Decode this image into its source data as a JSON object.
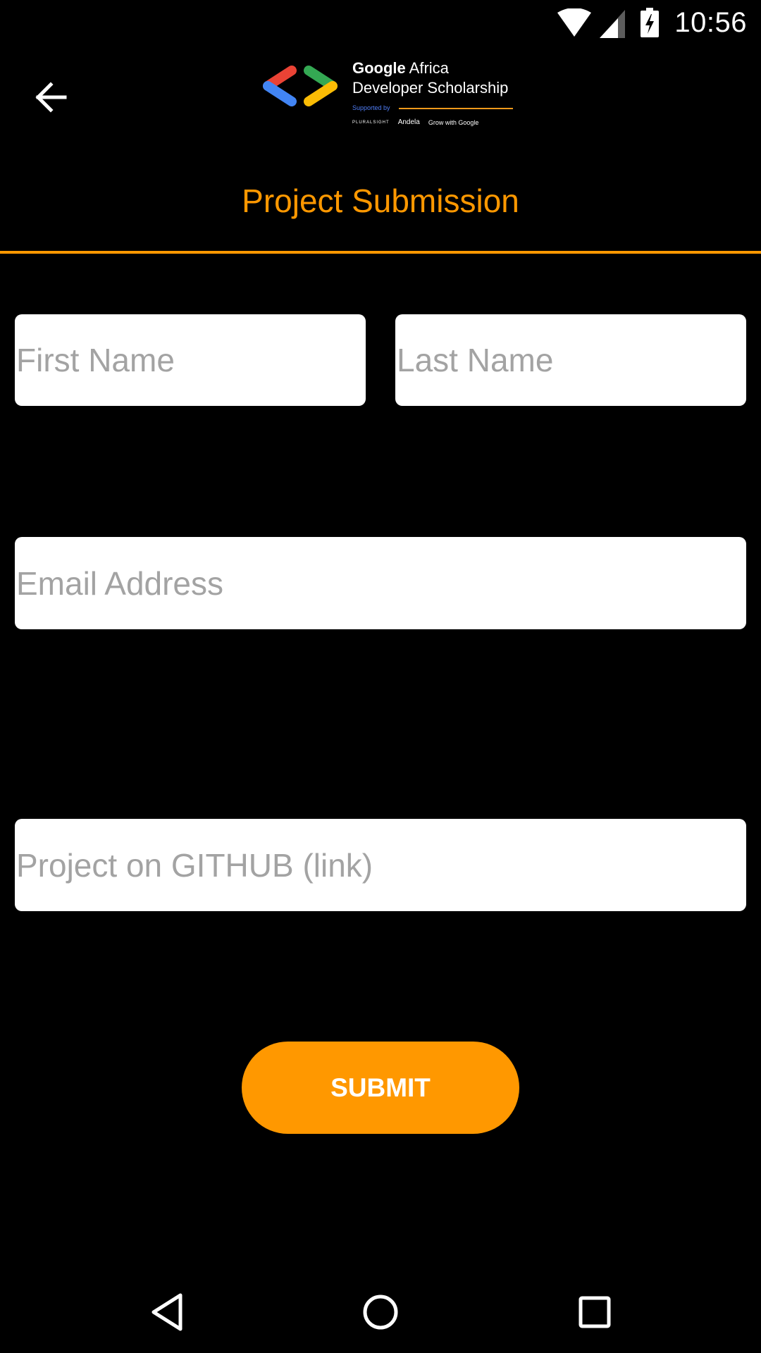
{
  "status_bar": {
    "time": "10:56",
    "icons": [
      "wifi-icon",
      "cellular-signal-icon",
      "battery-charging-icon"
    ]
  },
  "header": {
    "back_icon": "arrow-left-icon",
    "logo": {
      "line1_bold": "Google",
      "line1_rest": " Africa",
      "line2": "Developer Scholarship",
      "supported_by": "Supported by",
      "sponsors": [
        "PLURALSIGHT",
        "Andela",
        "Grow with Google"
      ]
    },
    "title": "Project Submission"
  },
  "form": {
    "first_name_placeholder": "First Name",
    "first_name_value": "",
    "last_name_placeholder": "Last Name",
    "last_name_value": "",
    "email_placeholder": "Email Address",
    "email_value": "",
    "github_placeholder": "Project on GITHUB (link)",
    "github_value": "",
    "submit_label": "SUBMIT"
  },
  "colors": {
    "accent": "#ff9800",
    "background": "#000000",
    "field_background": "#ffffff",
    "placeholder": "#a3a3a3"
  },
  "nav_bar": {
    "icons": [
      "nav-back-icon",
      "nav-home-icon",
      "nav-recents-icon"
    ]
  }
}
